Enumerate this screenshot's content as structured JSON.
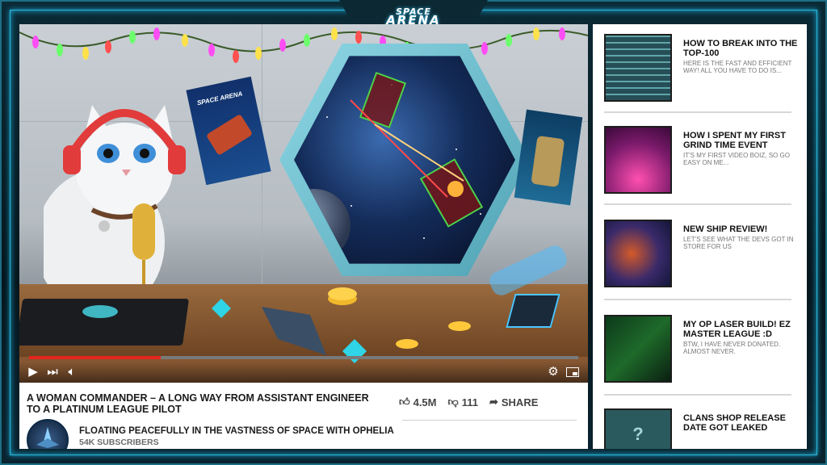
{
  "logo": {
    "line1": "SPACE",
    "line2": "ARENA"
  },
  "player": {
    "progress": 0.24,
    "icons": [
      "play-icon",
      "next-icon",
      "volume-icon",
      "settings-icon",
      "miniplayer-icon"
    ]
  },
  "video": {
    "title": "A WOMAN COMMANDER – A LONG WAY FROM ASSISTANT ENGINEER TO A PLATINUM LEAGUE PILOT",
    "likes": "4.5M",
    "dislikes": "111",
    "share_label": "SHARE",
    "channel_name": "FLOATING PEACEFULLY IN THE VASTNESS OF SPACE WITH OPHELIA",
    "subscribers": "54K SUBSCRIBERS"
  },
  "sidebar": {
    "items": [
      {
        "title": "HOW TO BREAK INTO THE TOP-100",
        "desc": "HERE IS THE FAST AND EFFICIENT WAY! ALL YOU HAVE TO DO IS..."
      },
      {
        "title": "HOW I SPENT MY FIRST GRIND TIME EVENT",
        "desc": "IT'S MY FIRST VIDEO BOIZ, SO GO EASY ON ME..."
      },
      {
        "title": "NEW SHIP REVIEW!",
        "desc": "LET'S SEE WHAT THE DEVS GOT IN STORE FOR US"
      },
      {
        "title": "MY OP LASER BUILD! EZ MASTER LEAGUE :D",
        "desc": "BTW, I HAVE NEVER DONATED. ALMOST NEVER."
      },
      {
        "title": "CLANS SHOP RELEASE DATE GOT LEAKED",
        "desc": ""
      }
    ]
  }
}
